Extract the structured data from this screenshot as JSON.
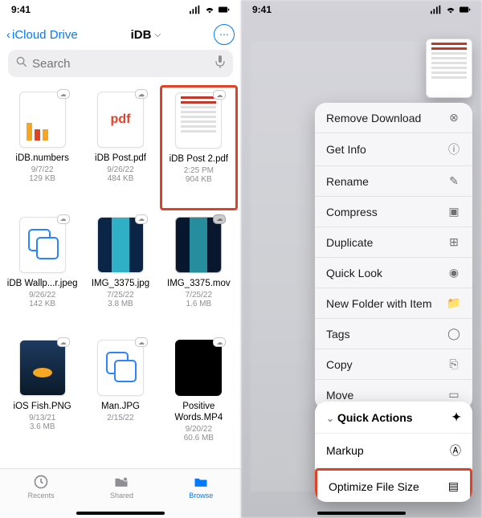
{
  "status": {
    "time": "9:41"
  },
  "nav": {
    "back": "iCloud Drive",
    "title": "iDB"
  },
  "search": {
    "placeholder": "Search"
  },
  "files": [
    {
      "name": "iDB.numbers",
      "date": "9/7/22",
      "size": "129 KB",
      "kind": "numbers"
    },
    {
      "name": "iDB Post.pdf",
      "date": "9/26/22",
      "size": "484 KB",
      "kind": "pdf",
      "glyph": "pdf"
    },
    {
      "name": "iDB Post 2.pdf",
      "date": "2:25 PM",
      "size": "904 KB",
      "kind": "doc",
      "highlight": true
    },
    {
      "name": "iDB Wallp...r.jpeg",
      "date": "9/26/22",
      "size": "142 KB",
      "kind": "dupe"
    },
    {
      "name": "IMG_3375.jpg",
      "date": "7/25/22",
      "size": "3.8 MB",
      "kind": "photo1"
    },
    {
      "name": "IMG_3375.mov",
      "date": "7/25/22",
      "size": "1.6 MB",
      "kind": "photo2"
    },
    {
      "name": "iOS Fish.PNG",
      "date": "9/13/21",
      "size": "3.6 MB",
      "kind": "fish"
    },
    {
      "name": "Man.JPG",
      "date": "2/15/22",
      "size": "",
      "kind": "dupe"
    },
    {
      "name": "Positive Words.MP4",
      "date": "9/20/22",
      "size": "60.6 MB",
      "kind": "black"
    }
  ],
  "tabs": {
    "recents": "Recents",
    "shared": "Shared",
    "browse": "Browse"
  },
  "menu": [
    {
      "label": "Remove Download",
      "icon": "⊗"
    },
    {
      "label": "Get Info",
      "icon": "ⓘ"
    },
    {
      "label": "Rename",
      "icon": "✎"
    },
    {
      "label": "Compress",
      "icon": "▣"
    },
    {
      "label": "Duplicate",
      "icon": "⊞"
    },
    {
      "label": "Quick Look",
      "icon": "◉"
    },
    {
      "label": "New Folder with Item",
      "icon": "📁"
    },
    {
      "label": "Tags",
      "icon": "◯"
    },
    {
      "label": "Copy",
      "icon": "⎘"
    },
    {
      "label": "Move",
      "icon": "▭"
    }
  ],
  "quick_actions": {
    "header": "Quick Actions",
    "items": [
      {
        "label": "Markup",
        "icon": "Ⓐ"
      },
      {
        "label": "Optimize File Size",
        "icon": "▤",
        "highlight": true
      }
    ]
  }
}
